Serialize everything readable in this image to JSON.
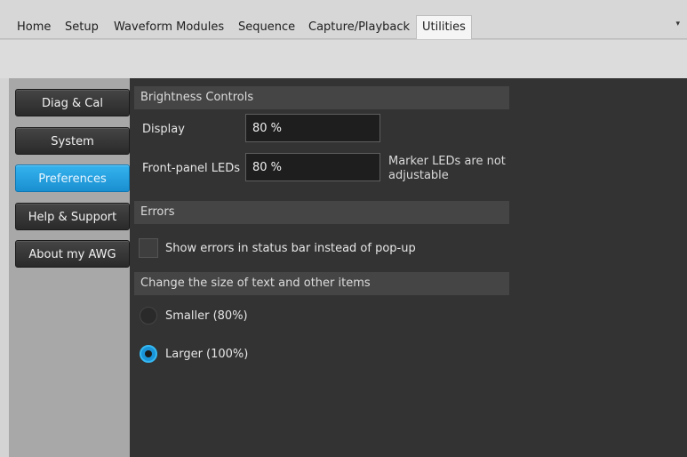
{
  "menu": {
    "items": [
      {
        "label": "Home"
      },
      {
        "label": "Setup"
      },
      {
        "label": "Waveform Modules"
      },
      {
        "label": "Sequence"
      },
      {
        "label": "Capture/Playback"
      },
      {
        "label": "Utilities"
      }
    ],
    "dropdown_glyph": "▾"
  },
  "sidebar": {
    "items": [
      {
        "label": "Diag & Cal"
      },
      {
        "label": "System"
      },
      {
        "label": "Preferences",
        "active": true
      },
      {
        "label": "Help & Support"
      },
      {
        "label": "About my AWG"
      }
    ]
  },
  "brightness": {
    "header": "Brightness Controls",
    "display_label": "Display",
    "display_value": "80 %",
    "leds_label": "Front-panel LEDs",
    "leds_value": "80 %",
    "leds_note": "Marker LEDs are not adjustable"
  },
  "errors": {
    "header": "Errors",
    "checkbox_label": "Show errors in status bar instead of pop-up",
    "checked": false
  },
  "text_size": {
    "header": "Change the size of text and other items",
    "option_small": "Smaller (80%)",
    "option_large": "Larger (100%)",
    "selected": "Larger (100%)"
  },
  "colors": {
    "accent": "#1a94d8",
    "content_bg": "#333333",
    "sidebar_bg": "#a8a8a8"
  }
}
